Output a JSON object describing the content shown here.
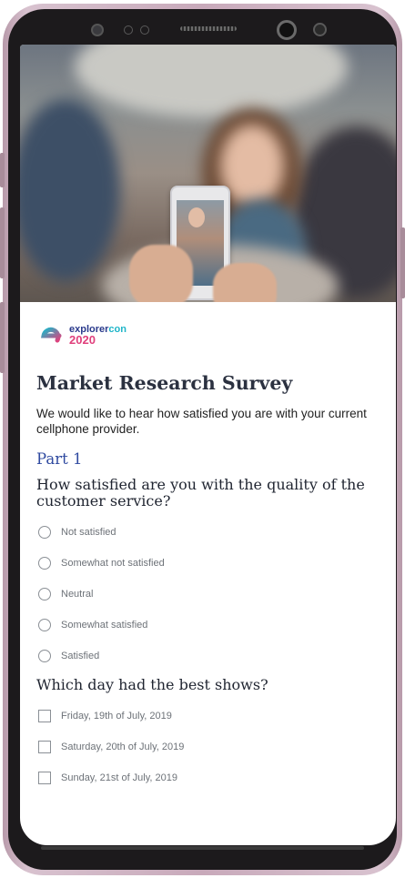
{
  "app": {
    "logo_line1_prefix": "explorer",
    "logo_line1_suffix": "con",
    "logo_line2": "2020"
  },
  "survey": {
    "title": "Market Research Survey",
    "intro": "We would like to hear how satisfied you are with your current cellphone provider.",
    "part_label": "Part 1",
    "question1": {
      "text": "How satisfied are you with the quality of the customer service?",
      "options": [
        "Not satisfied",
        "Somewhat not satisfied",
        "Neutral",
        "Somewhat satisfied",
        "Satisfied"
      ]
    },
    "question2": {
      "text": "Which day had the best shows?",
      "options": [
        "Friday, 19th of July, 2019",
        "Saturday, 20th of July, 2019",
        "Sunday, 21st of July, 2019"
      ]
    }
  },
  "colors": {
    "title": "#2b3140",
    "part_accent": "#2f4aa0",
    "logo_blue": "#2a3a8c",
    "logo_cyan": "#1fb5c8",
    "logo_pink": "#e0407c",
    "phone_frame": "#c8a9ba"
  },
  "icons": {
    "logo": "explorercon-e-logo-icon",
    "radio": "radio-unchecked-icon",
    "checkbox": "checkbox-unchecked-icon"
  }
}
